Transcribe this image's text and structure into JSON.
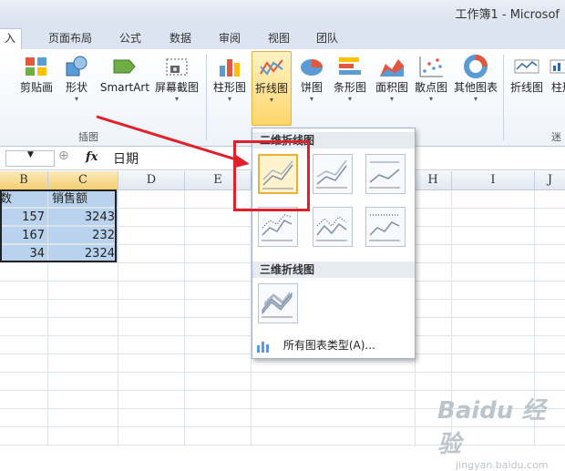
{
  "window": {
    "title": "工作簿1 - Microsof"
  },
  "tabs": [
    {
      "label": "入",
      "active": true
    },
    {
      "label": "页面布局"
    },
    {
      "label": "公式"
    },
    {
      "label": "数据"
    },
    {
      "label": "审阅"
    },
    {
      "label": "视图"
    },
    {
      "label": "团队"
    }
  ],
  "ribbon": {
    "buttons": [
      {
        "label": "剪贴画",
        "dd": ""
      },
      {
        "label": "形状",
        "dd": "▾"
      },
      {
        "label": "SmartArt",
        "dd": ""
      },
      {
        "label": "屏幕截图",
        "dd": "▾"
      },
      {
        "label": "柱形图",
        "dd": "▾"
      },
      {
        "label": "折线图",
        "dd": "▾"
      },
      {
        "label": "饼图",
        "dd": "▾"
      },
      {
        "label": "条形图",
        "dd": "▾"
      },
      {
        "label": "面积图",
        "dd": "▾"
      },
      {
        "label": "散点图",
        "dd": "▾"
      },
      {
        "label": "其他图表",
        "dd": "▾"
      },
      {
        "label": "折线图",
        "dd": ""
      },
      {
        "label": "柱形",
        "dd": ""
      }
    ],
    "group_illustrations": "插图",
    "group_sparklines": "迷"
  },
  "formula_bar": {
    "fx": "fx",
    "value": "日期"
  },
  "columns": [
    "B",
    "C",
    "D",
    "E",
    "H",
    "I",
    "J"
  ],
  "sheet": {
    "header": [
      "数",
      "销售额"
    ],
    "rows": [
      [
        "157",
        "3243"
      ],
      [
        "167",
        "232"
      ],
      [
        "34",
        "2324"
      ]
    ]
  },
  "dropdown": {
    "section1": "二维折线图",
    "section2": "三维折线图",
    "all_chart_types": "所有图表类型(A)..."
  },
  "colors": {
    "accent_red": "#e0202a",
    "selection": "#b9d2ee",
    "highlight": "#f5cf72"
  },
  "watermark": {
    "text": "Baidu 经验",
    "url": "jingyan.baidu.com"
  }
}
